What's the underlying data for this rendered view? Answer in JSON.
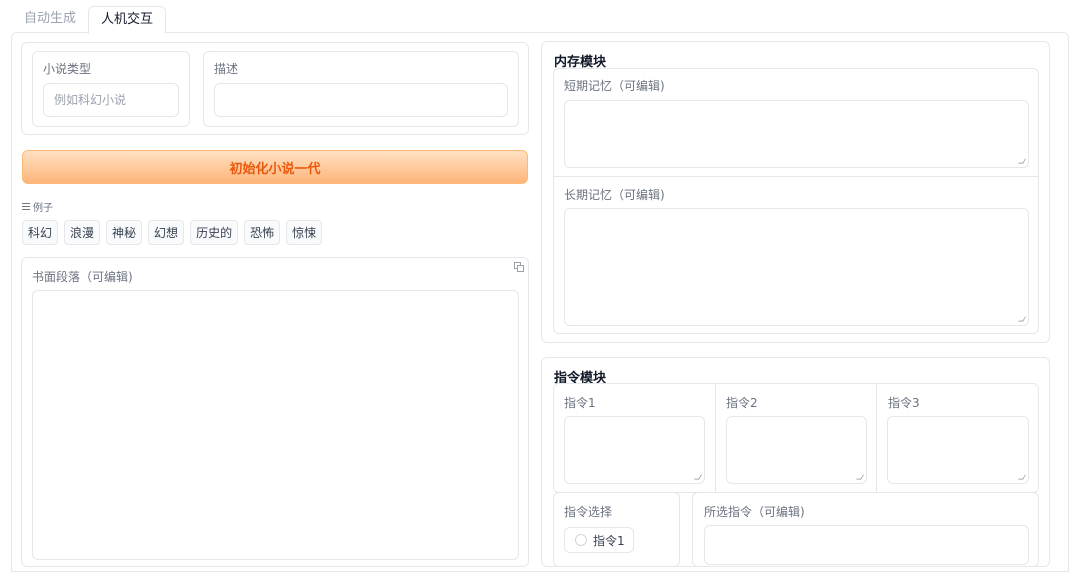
{
  "tabs": [
    {
      "label": "自动生成",
      "active": false
    },
    {
      "label": "人机交互",
      "active": true
    }
  ],
  "left": {
    "novel_type": {
      "label": "小说类型",
      "placeholder": "例如科幻小说",
      "value": ""
    },
    "description": {
      "label": "描述",
      "placeholder": "",
      "value": ""
    },
    "init_button": "初始化小说一代",
    "examples_label": "例子",
    "examples": [
      "科幻",
      "浪漫",
      "神秘",
      "幻想",
      "历史的",
      "恐怖",
      "惊悚"
    ],
    "written_paragraph": {
      "label": "书面段落（可编辑)",
      "value": ""
    }
  },
  "memory": {
    "title": "内存模块",
    "short_term": {
      "label": "短期记忆（可编辑)",
      "value": ""
    },
    "long_term": {
      "label": "长期记忆（可编辑)",
      "value": ""
    }
  },
  "instruction": {
    "title": "指令模块",
    "items": [
      {
        "label": "指令1",
        "value": ""
      },
      {
        "label": "指令2",
        "value": ""
      },
      {
        "label": "指令3",
        "value": ""
      }
    ],
    "select_label": "指令选择",
    "options": [
      "指令1"
    ],
    "selected_label": "所选指令（可编辑)"
  },
  "colors": {
    "accent": "#ea580c",
    "button_gradient_top": "#ffe1c2",
    "button_gradient_bottom": "#fdb57a",
    "border": "#e5e7eb"
  }
}
